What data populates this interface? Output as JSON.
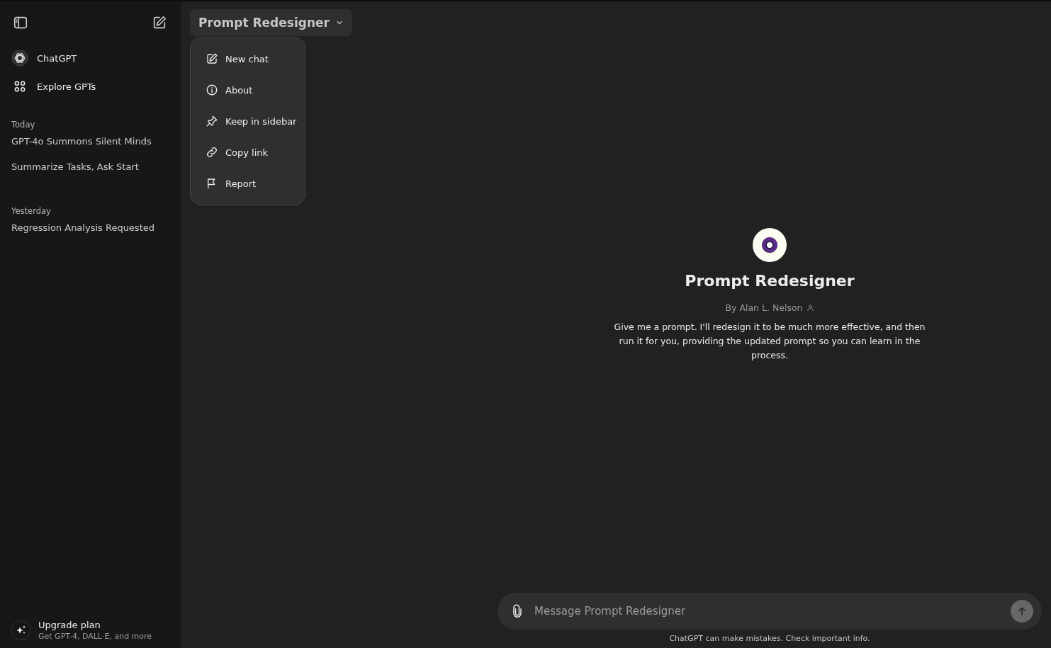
{
  "sidebar": {
    "items": [
      {
        "label": "ChatGPT",
        "kind": "chatgpt"
      },
      {
        "label": "Explore GPTs",
        "kind": "explore"
      }
    ],
    "history": [
      {
        "heading": "Today",
        "chats": [
          "GPT-4o Summons Silent Minds",
          "Summarize Tasks, Ask Start"
        ]
      },
      {
        "heading": "Yesterday",
        "chats": [
          "Regression Analysis Requested"
        ]
      }
    ],
    "upgrade": {
      "title": "Upgrade plan",
      "subtitle": "Get GPT-4, DALL·E, and more"
    }
  },
  "header": {
    "model_menu": "Prompt Redesigner",
    "expanded": true
  },
  "menu": [
    {
      "label": "New chat",
      "kind": "new"
    },
    {
      "label": "About",
      "kind": "about"
    },
    {
      "label": "Keep in sidebar",
      "kind": "pin"
    },
    {
      "label": "Copy link",
      "kind": "link"
    },
    {
      "label": "Report",
      "kind": "report"
    }
  ],
  "gpt": {
    "name": "Prompt Redesigner",
    "author": "By Alan L. Nelson",
    "description": "Give me a prompt. I'll redesign it to be much more effective, and then run it for you, providing the updated prompt so you can learn in the process."
  },
  "composer": {
    "placeholder": "Message Prompt Redesigner"
  },
  "footer": "ChatGPT can make mistakes. Check important info."
}
